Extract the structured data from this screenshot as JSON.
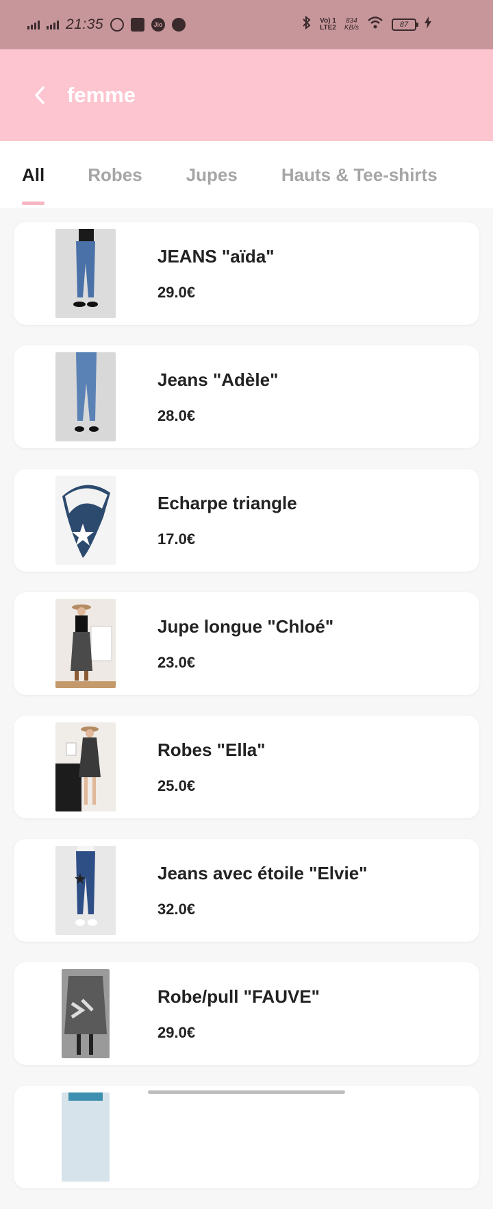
{
  "status": {
    "time": "21:35",
    "net1": "Vo) 1",
    "net2": "LTE2",
    "speed1": "834",
    "speed2": "KB/s",
    "battery": "87"
  },
  "header": {
    "title": "femme"
  },
  "tabs": [
    {
      "label": "All"
    },
    {
      "label": "Robes"
    },
    {
      "label": "Jupes"
    },
    {
      "label": "Hauts & Tee-shirts"
    }
  ],
  "products": [
    {
      "name": "JEANS \"aïda\"",
      "price": "29.0€",
      "image": "jeans-photo"
    },
    {
      "name": "Jeans \"Adèle\"",
      "price": "28.0€",
      "image": "jeans-photo"
    },
    {
      "name": "Echarpe triangle",
      "price": "17.0€",
      "image": "scarf-photo"
    },
    {
      "name": "Jupe longue \"Chloé\"",
      "price": "23.0€",
      "image": "skirt-photo"
    },
    {
      "name": "Robes \"Ella\"",
      "price": "25.0€",
      "image": "dress-photo"
    },
    {
      "name": "Jeans avec étoile \"Elvie\"",
      "price": "32.0€",
      "image": "jeans-photo"
    },
    {
      "name": "Robe/pull \"FAUVE\"",
      "price": "29.0€",
      "image": "sweater-dress-photo"
    }
  ],
  "colors": {
    "status_bar": "#c7969b",
    "app_bar": "#fdc5cf",
    "tab_indicator": "#f6b7c3"
  }
}
